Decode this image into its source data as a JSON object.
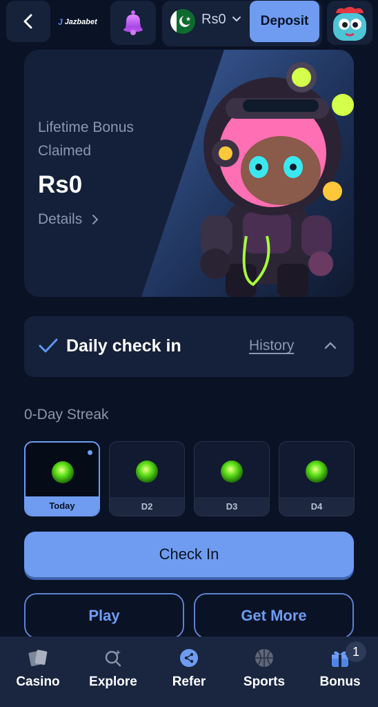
{
  "header": {
    "brand": "Jazbabet",
    "balance": "Rs0",
    "deposit_label": "Deposit",
    "icons": [
      "back-arrow-icon",
      "bell-icon",
      "pakistan-flag-icon",
      "chevron-down-icon",
      "avatar-icon"
    ]
  },
  "bonus_card": {
    "title": "Lifetime Bonus Claimed",
    "amount": "Rs0",
    "details_label": "Details"
  },
  "checkin": {
    "title": "Daily check in",
    "history_label": "History",
    "streak_label": "0-Day Streak",
    "days": [
      {
        "label": "Today"
      },
      {
        "label": "D2"
      },
      {
        "label": "D3"
      },
      {
        "label": "D4"
      }
    ],
    "checkin_button": "Check In",
    "play_button": "Play",
    "get_more_button": "Get More"
  },
  "bottom_nav": {
    "items": [
      {
        "label": "Casino",
        "icon": "cards-icon"
      },
      {
        "label": "Explore",
        "icon": "explore-icon"
      },
      {
        "label": "Refer",
        "icon": "share-icon"
      },
      {
        "label": "Sports",
        "icon": "basketball-icon"
      },
      {
        "label": "Bonus",
        "icon": "gift-icon"
      }
    ],
    "bonus_badge": "1"
  },
  "colors": {
    "background": "#0a1226",
    "accent": "#6f9cf0",
    "card": "#15203a",
    "muted_text": "#8a97ad"
  }
}
